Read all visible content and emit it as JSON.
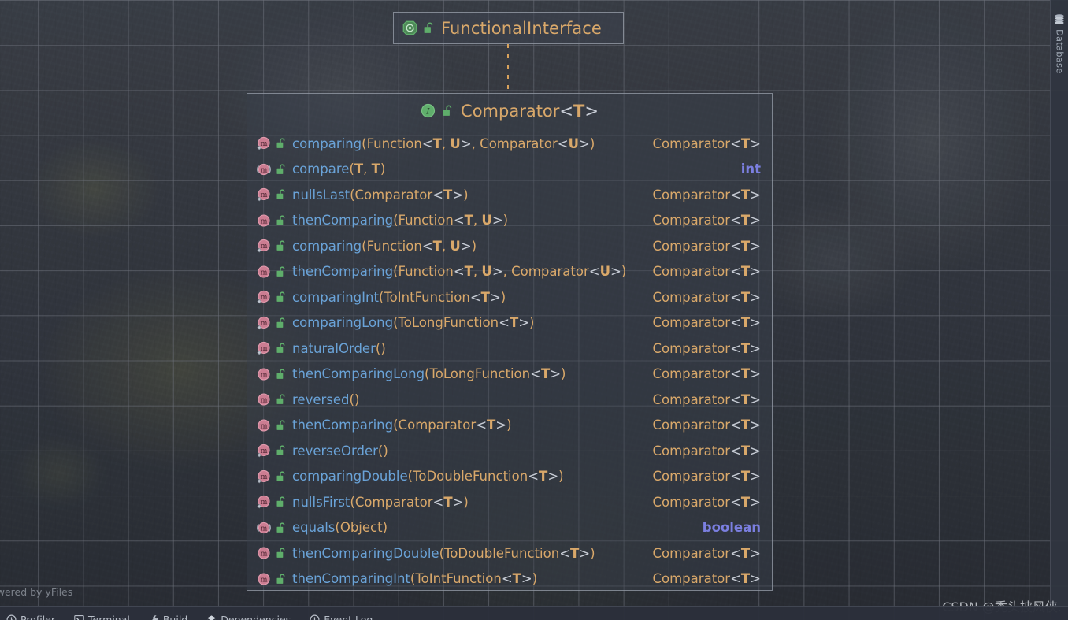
{
  "window": {
    "background_color": "#343a45",
    "grid_color": "#6e727c"
  },
  "right_tool_strip": {
    "tabs": [
      {
        "label": "Database",
        "icon": "database-icon"
      }
    ]
  },
  "diagram": {
    "credit": "Powered by yFiles",
    "connector": {
      "style": "dotted",
      "color": "#d8a25c"
    },
    "annotation_node": {
      "name": "FunctionalInterface",
      "icons": [
        "annotation-icon",
        "unlocked-padlock-icon"
      ],
      "title_color": "#d9a86a"
    },
    "class_node": {
      "icons": [
        "interface-icon",
        "unlocked-padlock-icon"
      ],
      "name": "Comparator",
      "type_params": "<T>",
      "full_title": "Comparator<T>",
      "members": [
        {
          "icon": "static-method-icon",
          "visibility": "unlocked-padlock-icon",
          "name": "comparing",
          "params": "(Function<T, U>, Comparator<U>)",
          "return": "Comparator<T>",
          "return_kind": "type"
        },
        {
          "icon": "abstract-method-icon",
          "visibility": "unlocked-padlock-icon",
          "name": "compare",
          "params": "(T, T)",
          "return": "int",
          "return_kind": "keyword"
        },
        {
          "icon": "static-method-icon",
          "visibility": "unlocked-padlock-icon",
          "name": "nullsLast",
          "params": "(Comparator<T>)",
          "return": "Comparator<T>",
          "return_kind": "type"
        },
        {
          "icon": "method-icon",
          "visibility": "unlocked-padlock-icon",
          "name": "thenComparing",
          "params": "(Function<T, U>)",
          "return": "Comparator<T>",
          "return_kind": "type"
        },
        {
          "icon": "static-method-icon",
          "visibility": "unlocked-padlock-icon",
          "name": "comparing",
          "params": "(Function<T, U>)",
          "return": "Comparator<T>",
          "return_kind": "type"
        },
        {
          "icon": "method-icon",
          "visibility": "unlocked-padlock-icon",
          "name": "thenComparing",
          "params": "(Function<T, U>, Comparator<U>)",
          "return": "Comparator<T>",
          "return_kind": "type"
        },
        {
          "icon": "static-method-icon",
          "visibility": "unlocked-padlock-icon",
          "name": "comparingInt",
          "params": "(ToIntFunction<T>)",
          "return": "Comparator<T>",
          "return_kind": "type"
        },
        {
          "icon": "static-method-icon",
          "visibility": "unlocked-padlock-icon",
          "name": "comparingLong",
          "params": "(ToLongFunction<T>)",
          "return": "Comparator<T>",
          "return_kind": "type"
        },
        {
          "icon": "static-method-icon",
          "visibility": "unlocked-padlock-icon",
          "name": "naturalOrder",
          "params": "()",
          "return": "Comparator<T>",
          "return_kind": "type"
        },
        {
          "icon": "method-icon",
          "visibility": "unlocked-padlock-icon",
          "name": "thenComparingLong",
          "params": "(ToLongFunction<T>)",
          "return": "Comparator<T>",
          "return_kind": "type"
        },
        {
          "icon": "method-icon",
          "visibility": "unlocked-padlock-icon",
          "name": "reversed",
          "params": "()",
          "return": "Comparator<T>",
          "return_kind": "type"
        },
        {
          "icon": "method-icon",
          "visibility": "unlocked-padlock-icon",
          "name": "thenComparing",
          "params": "(Comparator<T>)",
          "return": "Comparator<T>",
          "return_kind": "type"
        },
        {
          "icon": "static-method-icon",
          "visibility": "unlocked-padlock-icon",
          "name": "reverseOrder",
          "params": "()",
          "return": "Comparator<T>",
          "return_kind": "type"
        },
        {
          "icon": "static-method-icon",
          "visibility": "unlocked-padlock-icon",
          "name": "comparingDouble",
          "params": "(ToDoubleFunction<T>)",
          "return": "Comparator<T>",
          "return_kind": "type"
        },
        {
          "icon": "static-method-icon",
          "visibility": "unlocked-padlock-icon",
          "name": "nullsFirst",
          "params": "(Comparator<T>)",
          "return": "Comparator<T>",
          "return_kind": "type"
        },
        {
          "icon": "abstract-method-icon",
          "visibility": "unlocked-padlock-icon",
          "name": "equals",
          "params": "(Object)",
          "return": "boolean",
          "return_kind": "keyword"
        },
        {
          "icon": "method-icon",
          "visibility": "unlocked-padlock-icon",
          "name": "thenComparingDouble",
          "params": "(ToDoubleFunction<T>)",
          "return": "Comparator<T>",
          "return_kind": "type"
        },
        {
          "icon": "method-icon",
          "visibility": "unlocked-padlock-icon",
          "name": "thenComparingInt",
          "params": "(ToIntFunction<T>)",
          "return": "Comparator<T>",
          "return_kind": "type"
        }
      ]
    }
  },
  "bottom_bar": {
    "items": [
      {
        "label": "Profiler",
        "icon": "profiler-icon"
      },
      {
        "label": "Terminal",
        "icon": "terminal-icon"
      },
      {
        "label": "Build",
        "icon": "build-icon"
      },
      {
        "label": "Dependencies",
        "icon": "dependencies-icon"
      },
      {
        "label": "Event Log",
        "icon": "event-log-icon"
      }
    ]
  },
  "watermark": {
    "text": "CSDN @秃头披风侠."
  },
  "colors": {
    "method_name": "#6aa3d8",
    "type_text": "#d9a86a",
    "keyword": "#7b7fe0",
    "generic_angle": "#c8cdd6",
    "method_icon": "#d4788f",
    "padlock": "#59a869",
    "annotation_icon": "#59a869"
  }
}
